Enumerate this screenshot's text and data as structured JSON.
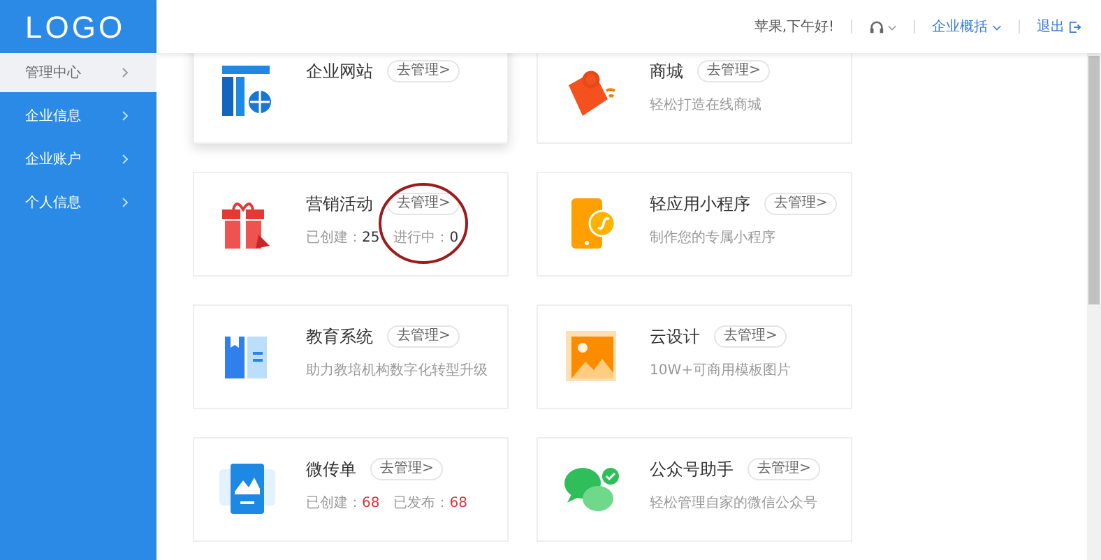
{
  "logo": "LOGO",
  "sidebar": {
    "items": [
      {
        "label": "管理中心",
        "selected": true
      },
      {
        "label": "企业信息",
        "selected": false
      },
      {
        "label": "企业账户",
        "selected": false
      },
      {
        "label": "个人信息",
        "selected": false
      }
    ]
  },
  "header": {
    "greeting": "苹果,下午好!",
    "company_menu": "企业概括",
    "logout": "退出"
  },
  "cards": [
    {
      "kind": "website",
      "title": "企业网站",
      "button": "去管理>",
      "elevated": true
    },
    {
      "kind": "mall",
      "title": "商城",
      "button": "去管理>",
      "subtitle": "轻松打造在线商城",
      "elevated": false
    },
    {
      "kind": "marketing",
      "title": "营销活动",
      "button": "去管理>",
      "elevated": false,
      "stats": [
        {
          "label": "已创建：",
          "value": "25",
          "color": "#333333"
        },
        {
          "label": "进行中：",
          "value": "0",
          "color": "#333333"
        }
      ]
    },
    {
      "kind": "miniapp",
      "title": "轻应用小程序",
      "button": "去管理>",
      "subtitle": "制作您的专属小程序",
      "elevated": false
    },
    {
      "kind": "education",
      "title": "教育系统",
      "button": "去管理>",
      "subtitle": "助力教培机构数字化转型升级",
      "elevated": false
    },
    {
      "kind": "design",
      "title": "云设计",
      "button": "去管理>",
      "subtitle": "10W+可商用模板图片",
      "elevated": false
    },
    {
      "kind": "flyer",
      "title": "微传单",
      "button": "去管理>",
      "elevated": false,
      "stats": [
        {
          "label": "已创建：",
          "value": "68",
          "color": "#d9363e"
        },
        {
          "label": "已发布：",
          "value": "68",
          "color": "#d9363e"
        }
      ]
    },
    {
      "kind": "wechat",
      "title": "公众号助手",
      "button": "去管理>",
      "subtitle": "轻松管理自家的微信公众号",
      "elevated": false
    }
  ]
}
